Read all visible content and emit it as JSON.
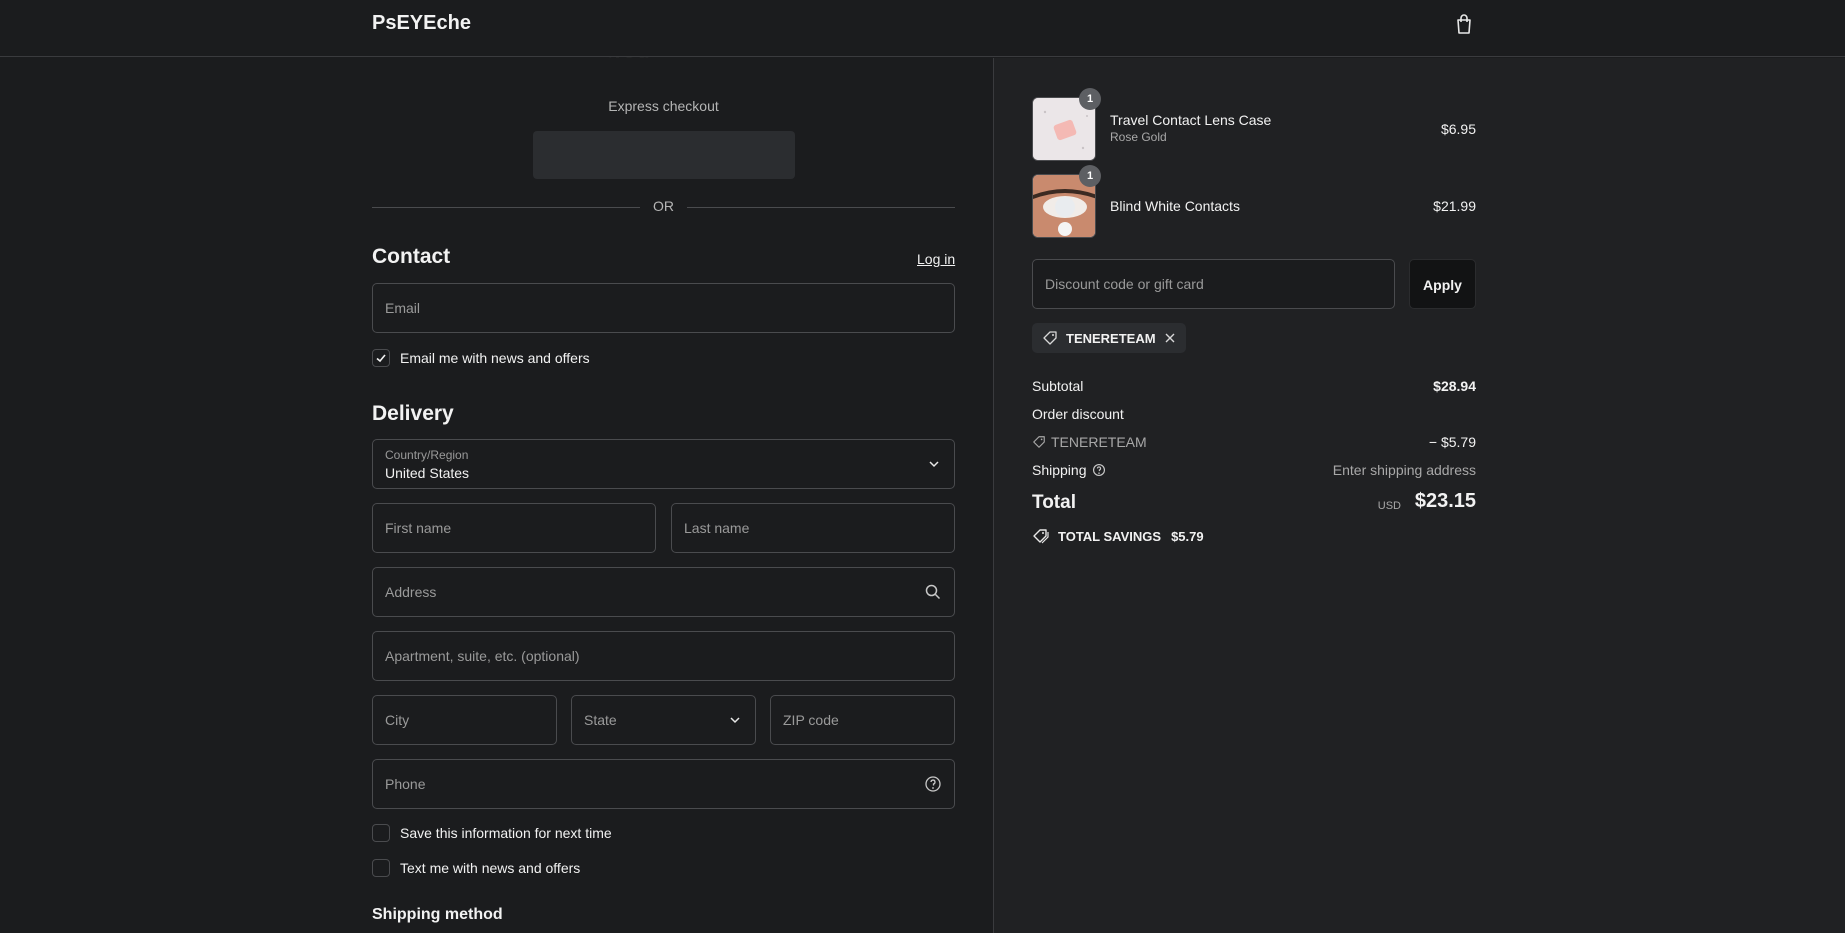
{
  "header": {
    "brand": "PsEYEche",
    "bag_icon": "shopping-bag-icon"
  },
  "express": {
    "label": "Express checkout",
    "or": "OR"
  },
  "contact": {
    "title": "Contact",
    "login": "Log in",
    "email_placeholder": "Email",
    "newsletter_label": "Email me with news and offers",
    "newsletter_checked": true
  },
  "delivery": {
    "title": "Delivery",
    "country_label": "Country/Region",
    "country_value": "United States",
    "first_name": "First name",
    "last_name": "Last name",
    "address": "Address",
    "apartment": "Apartment, suite, etc. (optional)",
    "city": "City",
    "state": "State",
    "zip": "ZIP code",
    "phone": "Phone",
    "save_info": "Save this information for next time",
    "text_me": "Text me with news and offers"
  },
  "shipping_method": {
    "title": "Shipping method"
  },
  "cart": {
    "items": [
      {
        "name": "Travel Contact Lens Case",
        "variant": "Rose Gold",
        "price": "$6.95",
        "qty": "1"
      },
      {
        "name": "Blind White Contacts",
        "variant": "",
        "price": "$21.99",
        "qty": "1"
      }
    ],
    "discount_placeholder": "Discount code or gift card",
    "apply": "Apply",
    "applied_code": "TENERETEAM"
  },
  "summary": {
    "subtotal_label": "Subtotal",
    "subtotal": "$28.94",
    "order_discount_label": "Order discount",
    "discount_code": "TENERETEAM",
    "discount_amount": "− $5.79",
    "shipping_label": "Shipping",
    "shipping_value": "Enter shipping address",
    "total_label": "Total",
    "currency": "USD",
    "total": "$23.15",
    "savings_label": "TOTAL SAVINGS",
    "savings_amount": "$5.79"
  },
  "watermark": "Tenereteam"
}
